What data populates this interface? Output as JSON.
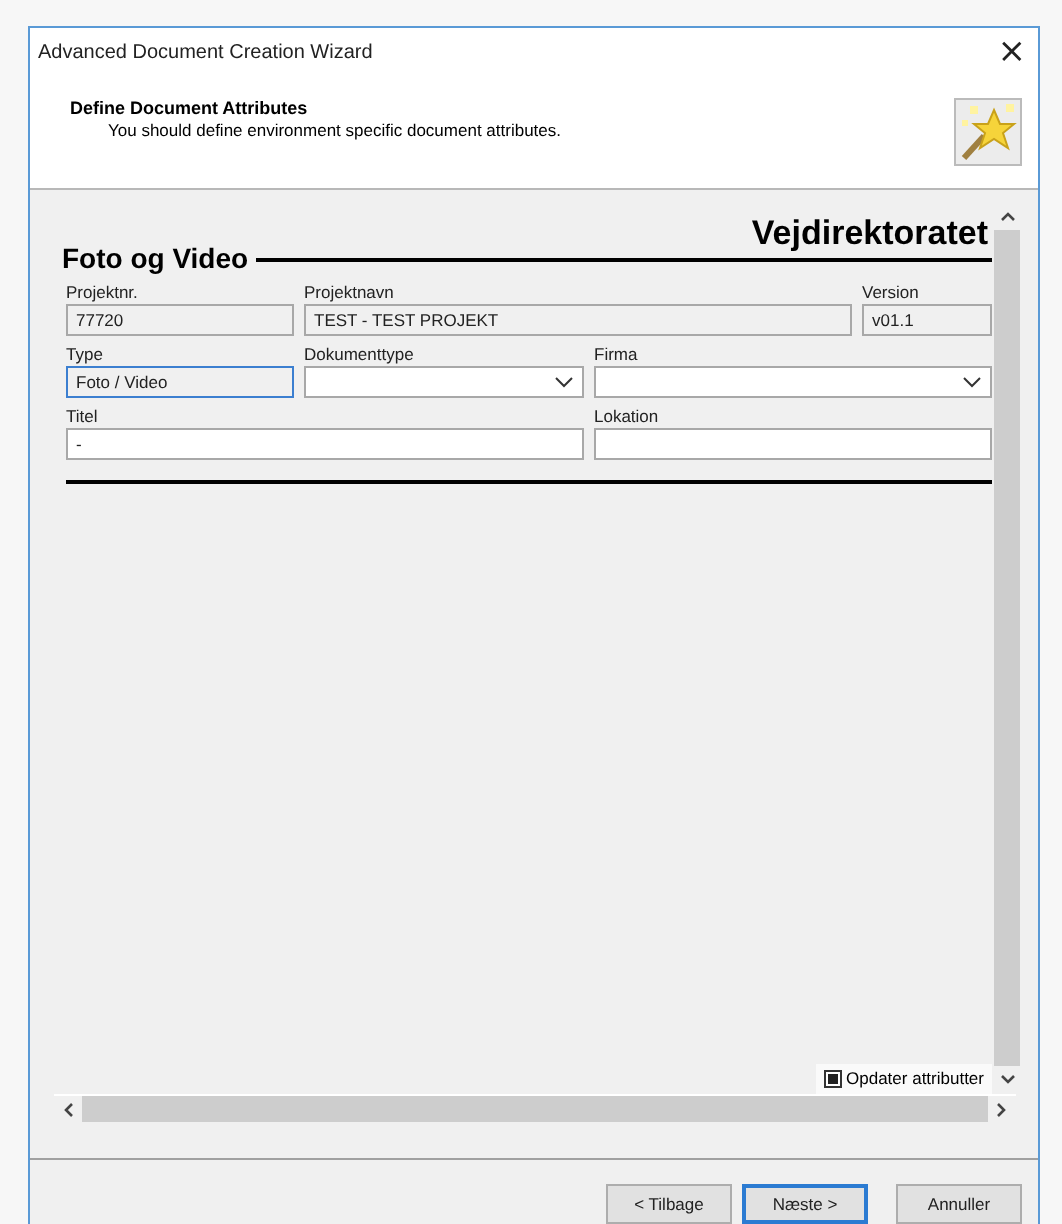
{
  "window": {
    "title": "Advanced Document Creation Wizard",
    "close": "×"
  },
  "header": {
    "title": "Define Document Attributes",
    "subtitle": "You should define environment specific document attributes."
  },
  "form": {
    "organization": "Vejdirektoratet",
    "section": "Foto og Video",
    "rows": [
      [
        {
          "label": "Projektnr.",
          "kind": "readonly",
          "value": "77720",
          "focused": false
        },
        {
          "label": "Projektnavn",
          "kind": "readonly",
          "value": "TEST - TEST PROJEKT",
          "focused": false
        },
        {
          "label": "Version",
          "kind": "readonly",
          "value": "v01.1",
          "focused": false
        }
      ],
      [
        {
          "label": "Type",
          "kind": "readonly",
          "value": "Foto / Video",
          "focused": true
        },
        {
          "label": "Dokumenttype",
          "kind": "dropdown",
          "focused": false
        },
        {
          "label": "Firma",
          "kind": "dropdown",
          "focused": false
        }
      ],
      [
        {
          "label": "Titel",
          "kind": "text",
          "value": "-",
          "focused": false
        },
        {
          "label": "Lokation",
          "kind": "text",
          "focused": false
        }
      ]
    ]
  },
  "update_attributes": {
    "label": "Opdater attributter",
    "checked": true
  },
  "buttons": [
    {
      "label": "< Tilbage",
      "default": false
    },
    {
      "label": "Næste >",
      "default": true
    },
    {
      "label": "Annuller",
      "default": false
    }
  ]
}
